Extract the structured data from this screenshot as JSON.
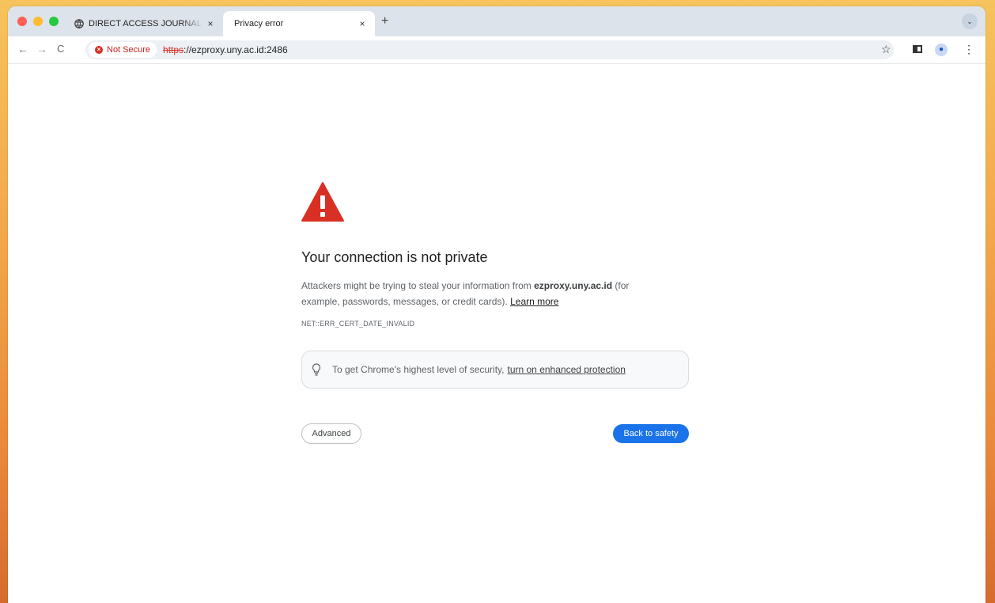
{
  "colors": {
    "accent": "#1a73e8",
    "warning": "#d93025",
    "tabbar": "#dde3ea"
  },
  "tabs": [
    {
      "title": "DIRECT ACCESS JOURNAL UNY",
      "icon": "globe-icon",
      "close": "×"
    },
    {
      "title": "Privacy error",
      "close": "×",
      "active": true
    }
  ],
  "toolbar": {
    "new_tab": "+",
    "back": "←",
    "forward": "→",
    "reload": "C",
    "security_chip": "Not Secure",
    "url_scheme": "https",
    "url_rest": "://ezproxy.uny.ac.id:2486",
    "bookmark": "☆",
    "menu": "⋮",
    "tab_search": "⌄"
  },
  "page": {
    "heading": "Your connection is not private",
    "body_prefix": "Attackers might be trying to steal your information from ",
    "host": "ezproxy.uny.ac.id",
    "body_suffix": " (for example, passwords, messages, or credit cards). ",
    "learn_more": "Learn more",
    "error_code": "NET::ERR_CERT_DATE_INVALID",
    "enhanced_text": "To get Chrome's highest level of security,",
    "enhanced_link": "turn on enhanced protection",
    "advanced_button": "Advanced",
    "back_button": "Back to safety"
  }
}
